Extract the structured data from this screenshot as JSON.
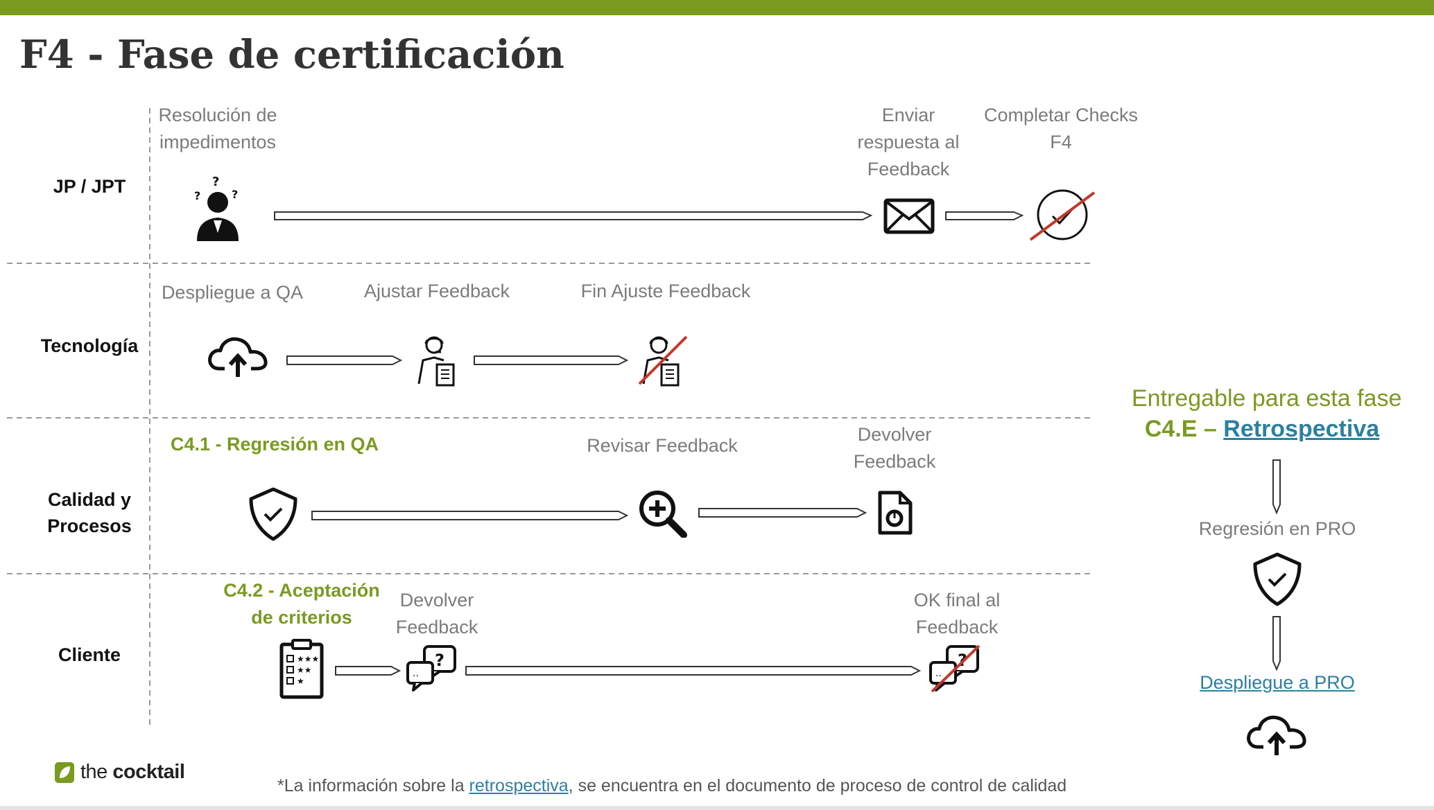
{
  "title": "F4 - Fase de certificación",
  "colors": {
    "accent": "#7a9a20",
    "link": "#2d7fa0",
    "strike": "#c0392b"
  },
  "lanes": [
    "JP / JPT",
    "Tecnología",
    "Calidad y Procesos",
    "Cliente"
  ],
  "lane_lines": {
    "calidad_1": "Calidad y",
    "calidad_2": "Procesos"
  },
  "jp": {
    "resolucion_1": "Resolución de",
    "resolucion_2": "impedimentos",
    "enviar_1": "Enviar",
    "enviar_2": "respuesta al",
    "enviar_3": "Feedback",
    "completar_1": "Completar Checks",
    "completar_2": "F4"
  },
  "tec": {
    "despliegue": "Despliegue a QA",
    "ajustar": "Ajustar Feedback",
    "fin": "Fin Ajuste Feedback"
  },
  "cal": {
    "c41": "C4.1 - Regresión en QA",
    "revisar": "Revisar Feedback",
    "devolver_1": "Devolver",
    "devolver_2": "Feedback"
  },
  "cli": {
    "c42_1": "C4.2 - Aceptación",
    "c42_2": "de criterios",
    "devolver_1": "Devolver",
    "devolver_2": "Feedback",
    "ok_1": "OK final al",
    "ok_2": "Feedback"
  },
  "deliverable": {
    "heading": "Entregable para esta fase",
    "code": "C4.E –",
    "link": "Retrospectiva",
    "regresion": "Regresión en PRO",
    "despliegue": "Despliegue a PRO"
  },
  "logo": {
    "the": "the",
    "brand": "cocktail"
  },
  "footnote": {
    "before": "*La información sobre la",
    "link": "retrospectiva",
    "after": ", se encuentra en el documento de proceso de control de calidad"
  },
  "icons": [
    "confused-person-icon",
    "envelope-icon",
    "check-circle-icon",
    "cloud-upload-icon",
    "support-agent-icon",
    "shield-check-icon",
    "zoom-in-icon",
    "document-icon",
    "checklist-icon",
    "chat-question-icon"
  ]
}
